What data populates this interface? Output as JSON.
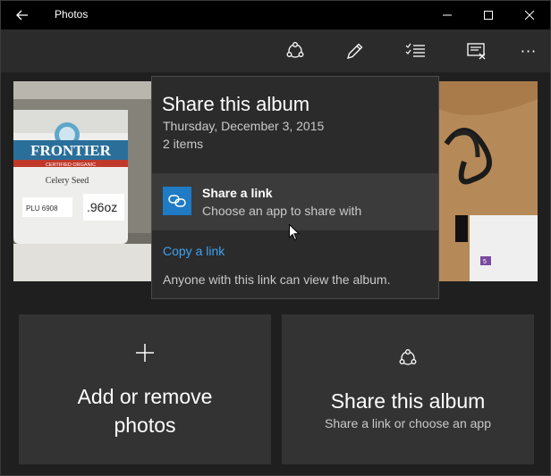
{
  "app": {
    "title": "Photos"
  },
  "titlebar": {
    "back_icon": "back-arrow-icon",
    "minimize_icon": "minimize-icon",
    "maximize_icon": "maximize-icon",
    "close_icon": "close-icon"
  },
  "toolbar": {
    "items": [
      {
        "icon": "share-icon"
      },
      {
        "icon": "pencil-icon"
      },
      {
        "icon": "select-list-icon"
      },
      {
        "icon": "slideshow-icon"
      },
      {
        "icon": "more-icon",
        "label": "···"
      }
    ]
  },
  "photos": [
    {
      "label_brand": "FRONTIER",
      "label_sub": "CERTIFIED ORGANIC",
      "label_name": "Celery Seed",
      "plu": "PLU 6908",
      "weight": ".96oz"
    },
    {
      "badge": "5"
    }
  ],
  "flyout": {
    "title": "Share this album",
    "date": "Thursday, December 3, 2015",
    "count": "2 items",
    "share_link": {
      "title": "Share a link",
      "subtitle": "Choose an app to share with",
      "icon": "link-icon"
    },
    "copy_link": "Copy a link",
    "note": "Anyone with this link can view the album."
  },
  "tiles": {
    "add": {
      "label": "Add or remove\nphotos",
      "icon": "plus-icon"
    },
    "share": {
      "title": "Share this album",
      "subtitle": "Share a link or choose an app",
      "icon": "share-icon"
    }
  },
  "colors": {
    "accent": "#1e7bc4",
    "link": "#3fa3f0",
    "background": "#1f1f1f"
  }
}
